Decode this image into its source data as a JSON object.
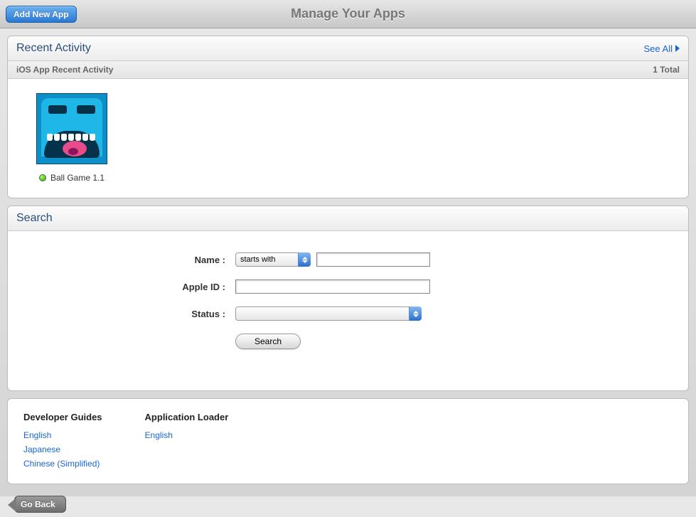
{
  "header": {
    "title": "Manage Your Apps",
    "add_button": "Add New App"
  },
  "recent": {
    "title": "Recent Activity",
    "see_all": "See All",
    "subtitle": "iOS App Recent Activity",
    "total_label": "1 Total",
    "apps": [
      {
        "name": "Ball Game 1.1",
        "status_color": "#3aa520"
      }
    ]
  },
  "search": {
    "title": "Search",
    "labels": {
      "name": "Name :",
      "apple_id": "Apple ID :",
      "status": "Status :"
    },
    "name_match_selected": "starts with",
    "name_value": "",
    "apple_id_value": "",
    "status_selected": "",
    "button": "Search"
  },
  "footer": {
    "guides_title": "Developer Guides",
    "guides_links": [
      "English",
      "Japanese",
      "Chinese (Simplified)"
    ],
    "loader_title": "Application Loader",
    "loader_links": [
      "English"
    ]
  },
  "nav": {
    "go_back": "Go Back"
  }
}
